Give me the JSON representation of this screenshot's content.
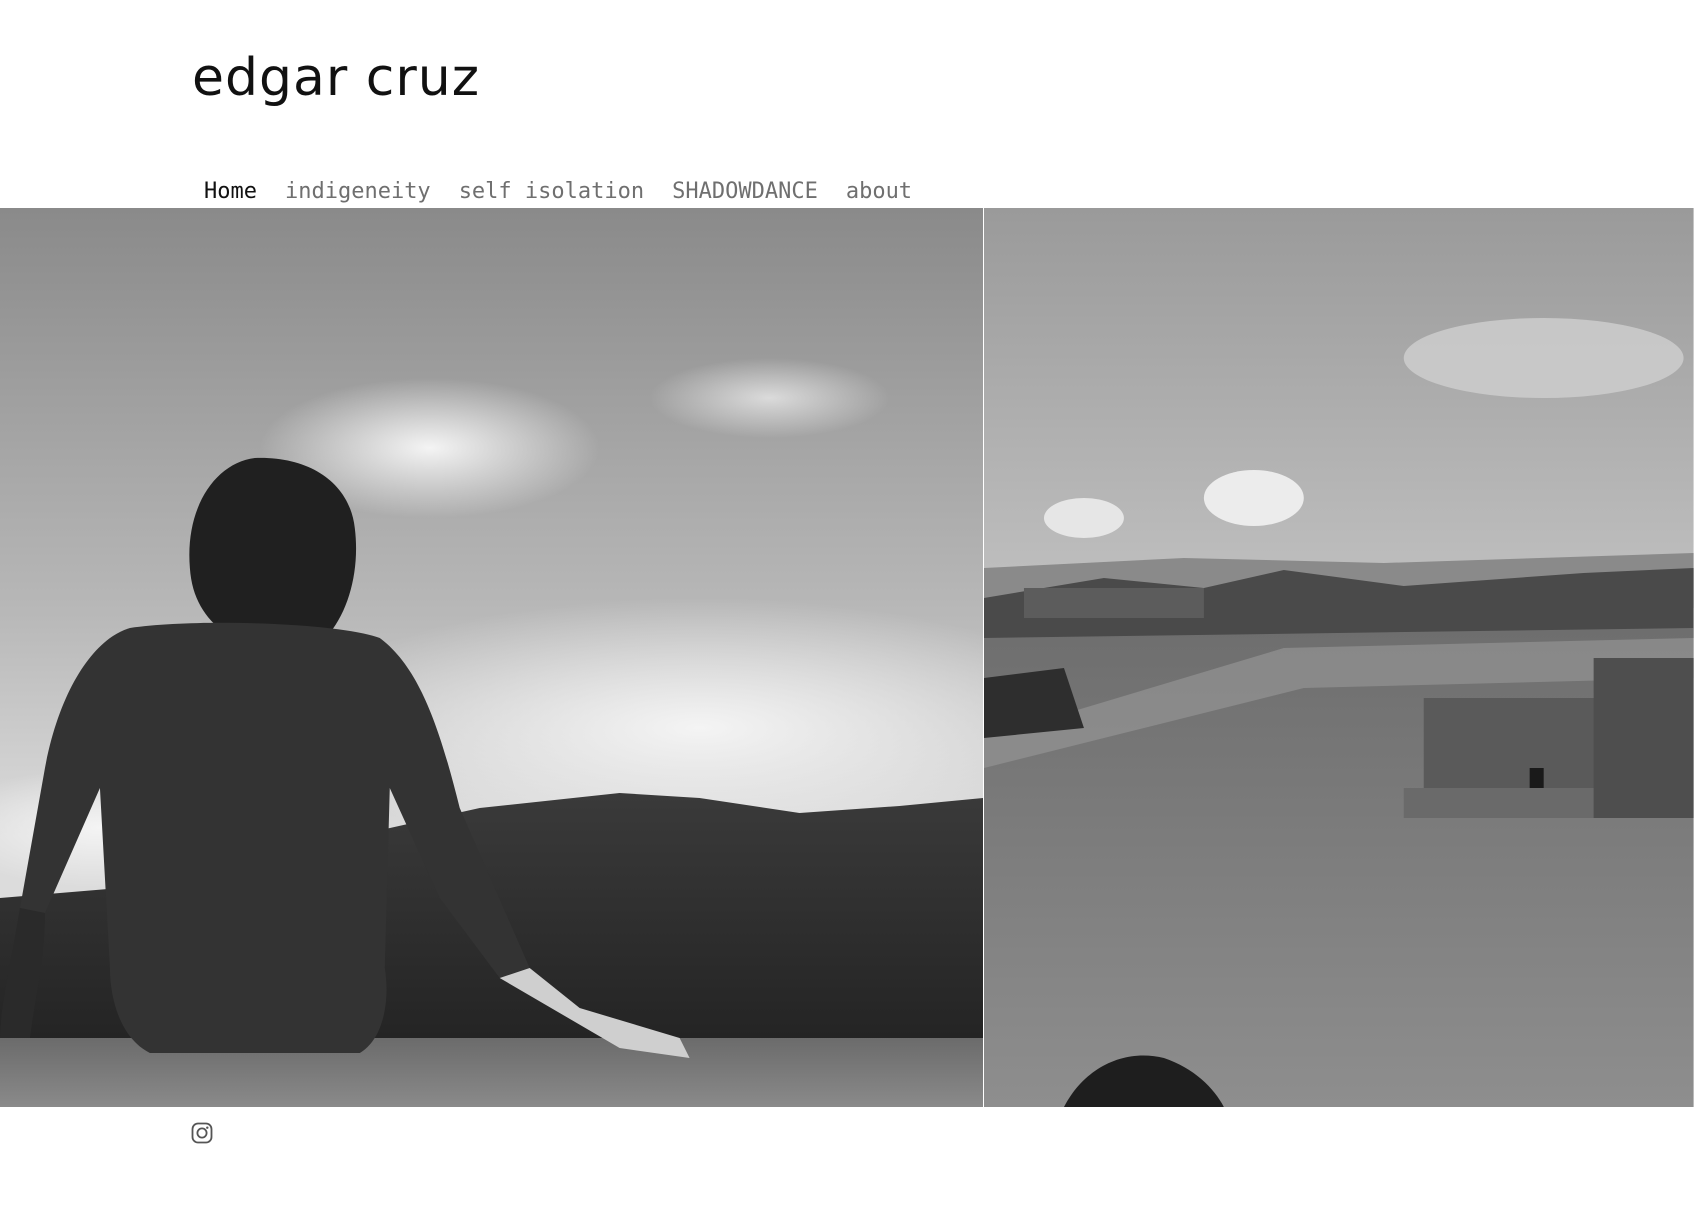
{
  "site": {
    "title": "edgar cruz"
  },
  "nav": {
    "items": [
      {
        "label": "Home",
        "active": true
      },
      {
        "label": "indigeneity",
        "active": false
      },
      {
        "label": "self isolation",
        "active": false
      },
      {
        "label": "SHADOWDANCE",
        "active": false
      },
      {
        "label": "about",
        "active": false
      }
    ]
  },
  "footer": {
    "social_icon": "instagram-icon"
  },
  "colors": {
    "text": "#111111",
    "nav_inactive": "#6f6f6f",
    "background": "#ffffff"
  }
}
